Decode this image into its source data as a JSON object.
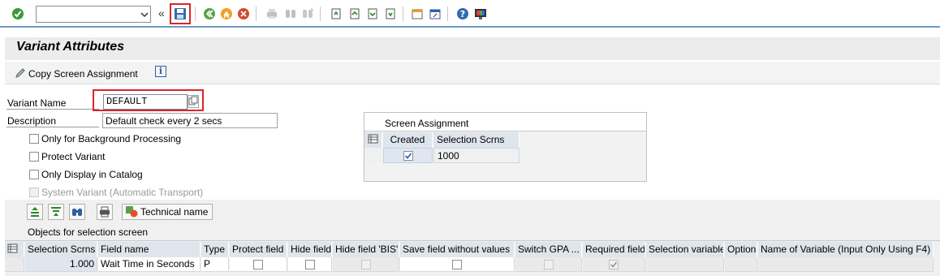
{
  "toolbar": {
    "command_value": "",
    "icons": [
      "enter-icon",
      "command-dropdown-icon",
      "collapse-chevron-icon",
      "save-icon",
      "back-icon",
      "exit-icon",
      "cancel-icon",
      "print-icon",
      "find-icon",
      "find-next-icon",
      "first-page-icon",
      "previous-page-icon",
      "next-page-icon",
      "last-page-icon",
      "create-session-icon",
      "shortcut-icon",
      "help-icon",
      "customize-layout-icon"
    ],
    "chevron": "«"
  },
  "page": {
    "title": "Variant Attributes",
    "copy_screen_label": "Copy Screen Assignment",
    "info_glyph": "i"
  },
  "form": {
    "variant_name_label": "Variant Name",
    "variant_name_value": "DEFAULT",
    "description_label": "Description",
    "description_value": "Default check every 2 secs",
    "checkboxes": [
      {
        "label": "Only for Background Processing",
        "checked": false,
        "disabled": false
      },
      {
        "label": "Protect Variant",
        "checked": false,
        "disabled": false
      },
      {
        "label": "Only Display in Catalog",
        "checked": false,
        "disabled": false
      },
      {
        "label": "System Variant (Automatic Transport)",
        "checked": false,
        "disabled": true
      }
    ]
  },
  "screen_assignment": {
    "title": "Screen Assignment",
    "col_created": "Created",
    "col_selection": "Selection Scrns",
    "rows": [
      {
        "created": true,
        "selection": "1000"
      }
    ]
  },
  "objects_grid": {
    "technical_name_label": "Technical name",
    "title": "Objects for selection screen",
    "columns": [
      "Selection Scrns",
      "Field name",
      "Type",
      "Protect field",
      "Hide field",
      "Hide field 'BIS'",
      "Save field without values",
      "Switch GPA ...",
      "Required field",
      "Selection variable",
      "Option",
      "Name of Variable (Input Only Using F4)"
    ],
    "rows": [
      {
        "selection": "1.000",
        "field_name": "Wait Time in Seconds",
        "type": "P",
        "protect": false,
        "hide": false,
        "hide_bis": false,
        "save_without": false,
        "switch_gpa": false,
        "required": true,
        "sel_var": "",
        "option": "",
        "var_name": ""
      }
    ]
  },
  "colors": {
    "accent_red": "#d9262b",
    "header_blue": "#dfe5ec",
    "toolbar_line": "#6a9ac8"
  }
}
